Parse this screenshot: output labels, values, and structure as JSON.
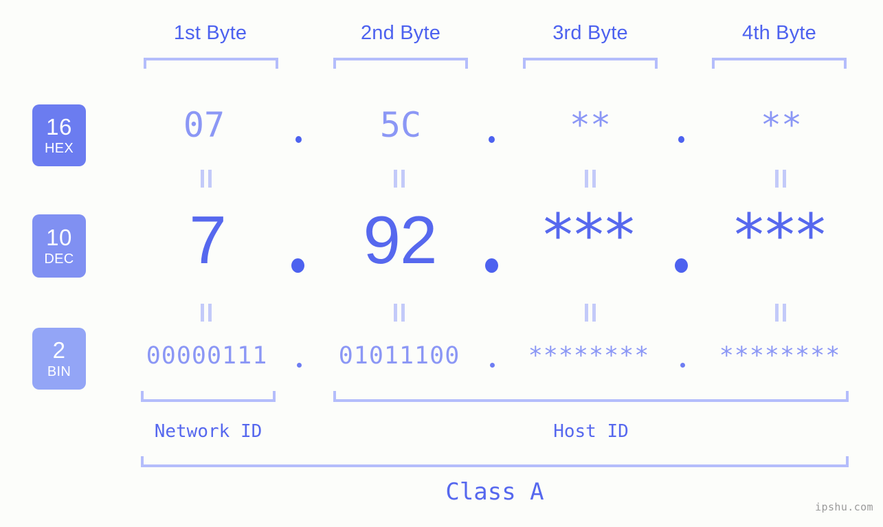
{
  "background_color": "#fcfdfa",
  "accent_color": "#5668ee",
  "accent_light": "#8b97f5",
  "bracket_color": "#b4bdfb",
  "byte_headers": [
    {
      "label": "1st Byte"
    },
    {
      "label": "2nd Byte"
    },
    {
      "label": "3rd Byte"
    },
    {
      "label": "4th Byte"
    }
  ],
  "radix_badges": [
    {
      "number": "16",
      "name": "HEX",
      "color": "#6b7cf0"
    },
    {
      "number": "10",
      "name": "DEC",
      "color": "#8090f2"
    },
    {
      "number": "2",
      "name": "BIN",
      "color": "#93a5f6"
    }
  ],
  "rows": {
    "hex": {
      "radix": "16",
      "radix_name": "HEX",
      "values": [
        "07",
        "5C",
        "**",
        "**"
      ],
      "separator": "."
    },
    "dec": {
      "radix": "10",
      "radix_name": "DEC",
      "values": [
        "7",
        "92",
        "***",
        "***"
      ],
      "separator": "."
    },
    "bin": {
      "radix": "2",
      "radix_name": "BIN",
      "values": [
        "00000111",
        "01011100",
        "********",
        "********"
      ],
      "separator": "."
    }
  },
  "equals_marker": "||",
  "sections": {
    "network_id": "Network ID",
    "host_id": "Host ID",
    "class": "Class A"
  },
  "watermark": "ipshu.com"
}
